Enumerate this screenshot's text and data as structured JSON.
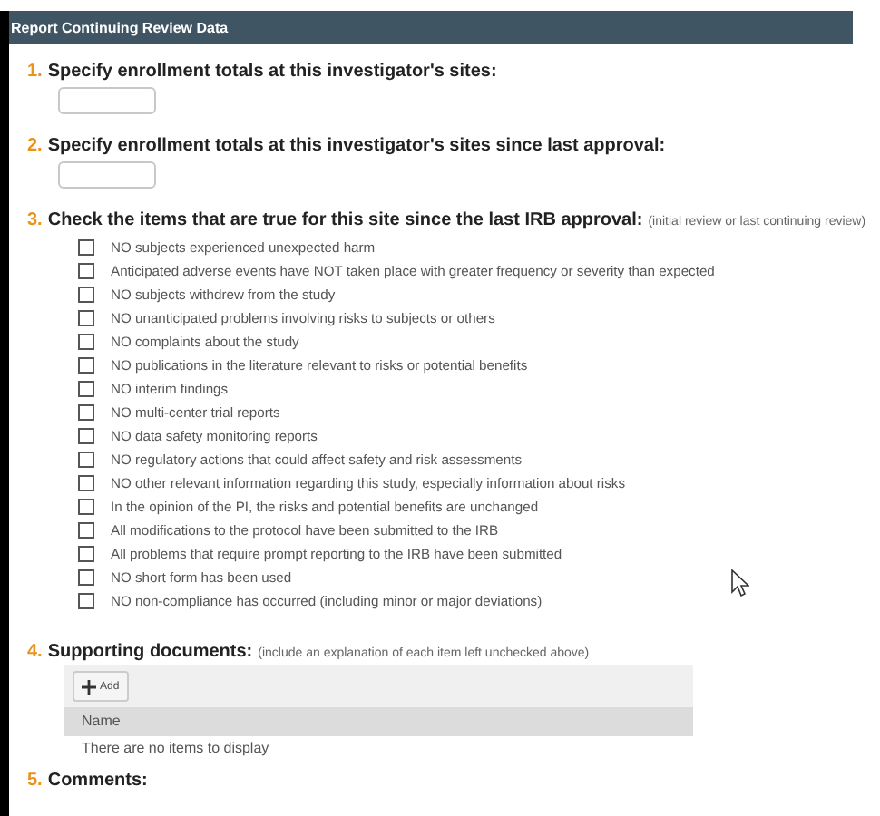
{
  "window": {
    "title": "Report Continuing Review Data"
  },
  "questions": [
    {
      "number": "1.",
      "kind": "input",
      "label": "Specify enrollment totals at this investigator's sites:"
    },
    {
      "number": "2.",
      "kind": "input",
      "label": "Specify enrollment totals at this investigator's sites since last approval:"
    },
    {
      "number": "3.",
      "kind": "checklist",
      "label": "Check the items that are true for this site since the last IRB approval:",
      "note": "(initial review or last continuing review)",
      "items": [
        {
          "label": "NO subjects experienced unexpected harm",
          "checked": false
        },
        {
          "label": "Anticipated adverse events have NOT taken place with greater frequency or severity than expected",
          "checked": false
        },
        {
          "label": "NO subjects withdrew from the study",
          "checked": false
        },
        {
          "label": "NO unanticipated problems involving risks to subjects or others",
          "checked": false
        },
        {
          "label": "NO complaints about the study",
          "checked": false
        },
        {
          "label": "NO publications in the literature relevant to risks or potential benefits",
          "checked": false
        },
        {
          "label": "NO interim findings",
          "checked": false
        },
        {
          "label": "NO multi-center trial reports",
          "checked": false
        },
        {
          "label": "NO data safety monitoring reports",
          "checked": false
        },
        {
          "label": "NO regulatory actions that could affect safety and risk assessments",
          "checked": false
        },
        {
          "label": "NO other relevant information regarding this study, especially information about risks",
          "checked": false
        },
        {
          "label": "In the opinion of the PI, the risks and potential benefits are unchanged",
          "checked": false
        },
        {
          "label": "All modifications to the protocol have been submitted to the IRB",
          "checked": false
        },
        {
          "label": "All problems that require prompt reporting to the IRB have been submitted",
          "checked": false
        },
        {
          "label": "NO short form has been used",
          "checked": false
        },
        {
          "label": "NO non-compliance has occurred (including minor or major deviations)",
          "checked": false
        }
      ]
    },
    {
      "number": "4.",
      "kind": "documents",
      "label": "Supporting documents:",
      "note": "(include an explanation of each item left unchecked above)",
      "add_button": "Add",
      "column": "Name",
      "empty_text": "There are no items to display"
    },
    {
      "number": "5.",
      "kind": "heading",
      "label": "Comments:"
    }
  ]
}
